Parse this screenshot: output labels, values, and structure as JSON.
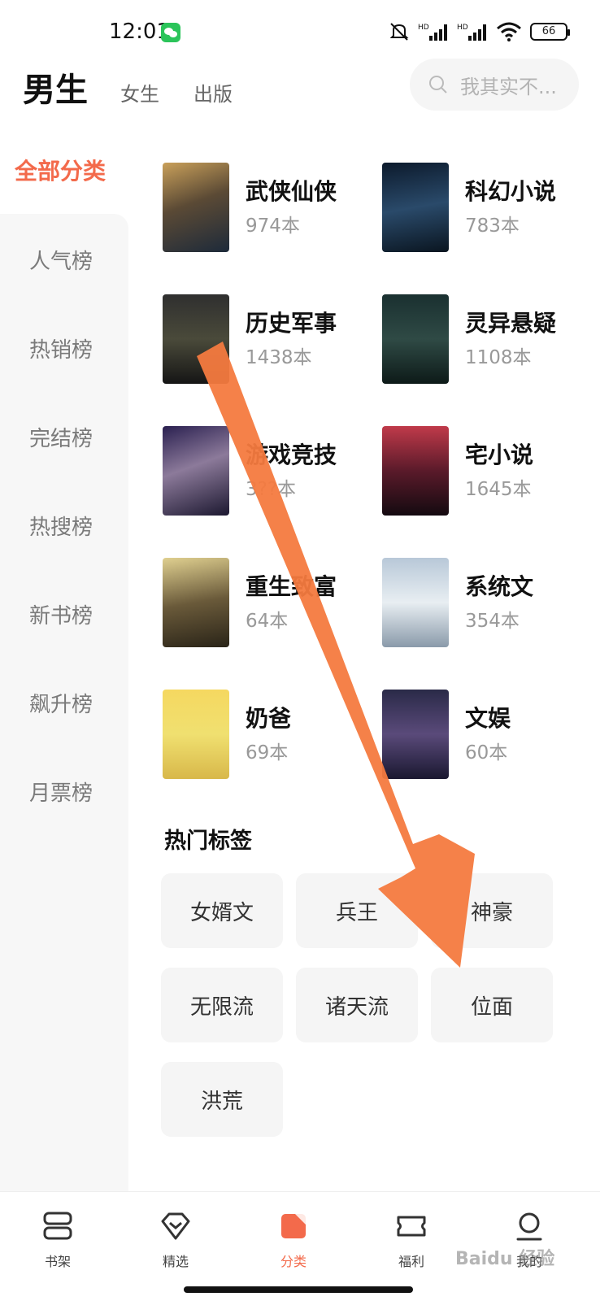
{
  "status_bar": {
    "time": "12:01",
    "battery": "66"
  },
  "header": {
    "tabs": [
      "男生",
      "女生",
      "出版"
    ],
    "search_placeholder": "我其实不..."
  },
  "sidebar": {
    "active": "全部分类",
    "items": [
      "人气榜",
      "热销榜",
      "完结榜",
      "热搜榜",
      "新书榜",
      "飙升榜",
      "月票榜"
    ]
  },
  "categories": [
    {
      "name": "武侠仙侠",
      "count": "974本"
    },
    {
      "name": "科幻小说",
      "count": "783本"
    },
    {
      "name": "历史军事",
      "count": "1438本"
    },
    {
      "name": "灵异悬疑",
      "count": "1108本"
    },
    {
      "name": "游戏竞技",
      "count": "3??本"
    },
    {
      "name": "宅小说",
      "count": "1645本"
    },
    {
      "name": "重生致富",
      "count": "64本"
    },
    {
      "name": "系统文",
      "count": "354本"
    },
    {
      "name": "奶爸",
      "count": "69本"
    },
    {
      "name": "文娱",
      "count": "60本"
    }
  ],
  "hot_tags": {
    "title": "热门标签",
    "tags": [
      "女婿文",
      "兵王",
      "神豪",
      "无限流",
      "诸天流",
      "位面",
      "洪荒"
    ]
  },
  "bottom_nav": {
    "items": [
      "书架",
      "精选",
      "分类",
      "福利",
      "我的"
    ],
    "active_index": 2
  },
  "watermark": "Baidu 经验",
  "colors": {
    "accent": "#f36a4b",
    "arrow": "#f47a3f"
  }
}
